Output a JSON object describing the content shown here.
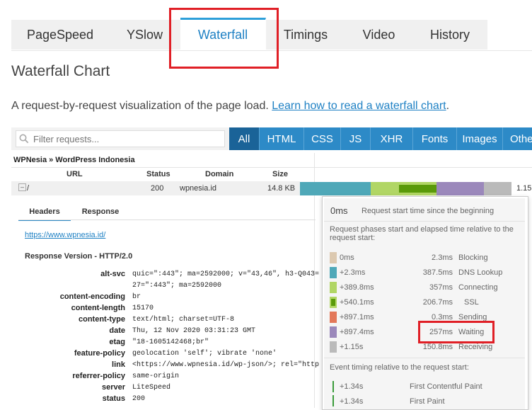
{
  "tabs": [
    {
      "label": "PageSpeed",
      "active": false
    },
    {
      "label": "YSlow",
      "active": false
    },
    {
      "label": "Waterfall",
      "active": true
    },
    {
      "label": "Timings",
      "active": false
    },
    {
      "label": "Video",
      "active": false
    },
    {
      "label": "History",
      "active": false
    }
  ],
  "page_title": "Waterfall Chart",
  "subtitle": {
    "text": "A request-by-request visualization of the page load. ",
    "link": "Learn how to read a waterfall chart",
    "end": "."
  },
  "filter": {
    "placeholder": "Filter requests...",
    "buttons": [
      {
        "label": "All",
        "active": true
      },
      {
        "label": "HTML",
        "active": false
      },
      {
        "label": "CSS",
        "active": false
      },
      {
        "label": "JS",
        "active": false
      },
      {
        "label": "XHR",
        "active": false
      },
      {
        "label": "Fonts",
        "active": false
      },
      {
        "label": "Images",
        "active": false
      },
      {
        "label": "Othe",
        "active": false
      }
    ]
  },
  "table": {
    "site": "WPNesia » WordPress Indonesia",
    "headers": {
      "url": "URL",
      "status": "Status",
      "domain": "Domain",
      "size": "Size"
    },
    "row": {
      "toggle": "–",
      "url": "/",
      "status": "200",
      "domain": "wpnesia.id",
      "size": "14.8 KB",
      "time_label": "1.15"
    }
  },
  "details": {
    "tabs": [
      {
        "label": "Headers",
        "active": true
      },
      {
        "label": "Response",
        "active": false
      }
    ],
    "link": "https://www.wpnesia.id/",
    "response_version": "Response Version - HTTP/2.0",
    "headers": [
      {
        "key": "alt-svc",
        "value": "quic=\":443\"; ma=2592000; v=\"43,46\", h3-Q043=",
        "value2": "27=\":443\"; ma=2592000"
      },
      {
        "key": "content-encoding",
        "value": "br"
      },
      {
        "key": "content-length",
        "value": "15170"
      },
      {
        "key": "content-type",
        "value": "text/html; charset=UTF-8"
      },
      {
        "key": "date",
        "value": "Thu, 12 Nov 2020 03:31:23 GMT"
      },
      {
        "key": "etag",
        "value": "\"18-1605142468;br\""
      },
      {
        "key": "feature-policy",
        "value": "geolocation 'self'; vibrate 'none'"
      },
      {
        "key": "link",
        "value": "<https://www.wpnesia.id/wp-json/>; rel=\"http"
      },
      {
        "key": "referrer-policy",
        "value": "same-origin"
      },
      {
        "key": "server",
        "value": "LiteSpeed"
      },
      {
        "key": "status",
        "value": "200"
      }
    ]
  },
  "tooltip": {
    "start_value": "0ms",
    "start_desc": "Request start time since the beginning",
    "phases_desc": "Request phases start and elapsed time relative to the request start:",
    "phases": [
      {
        "start": "0ms",
        "duration": "2.3ms",
        "name": "Blocking",
        "color": "#dcc9b0",
        "fraction": 0.002
      },
      {
        "start": "+2.3ms",
        "duration": "387.5ms",
        "name": "DNS Lookup",
        "color": "#4fa8b8",
        "fraction": 0.337
      },
      {
        "start": "+389.8ms",
        "duration": "357ms",
        "name": "Connecting",
        "color": "#b1d665",
        "fraction": 0.31
      },
      {
        "start": "+540.1ms",
        "duration": "206.7ms",
        "name": "SSL",
        "color": "#5a9a0a",
        "fraction": 0.18
      },
      {
        "start": "+897.1ms",
        "duration": "0.3ms",
        "name": "Sending",
        "color": "#e3785a",
        "fraction": 0.0003
      },
      {
        "start": "+897.4ms",
        "duration": "257ms",
        "name": "Waiting",
        "color": "#9b88bb",
        "fraction": 0.223
      },
      {
        "start": "+1.15s",
        "duration": "150.8ms",
        "name": "Receiving",
        "color": "#bababa",
        "fraction": 0.131
      }
    ],
    "event_desc": "Event timing relative to the request start:",
    "events": [
      {
        "time": "+1.34s",
        "name": "First Contentful Paint"
      },
      {
        "time": "+1.34s",
        "name": "First Paint"
      }
    ]
  },
  "colors": {
    "accent": "#2d8ac7",
    "active_filter": "#1a6398",
    "highlight": "#e01f26"
  }
}
